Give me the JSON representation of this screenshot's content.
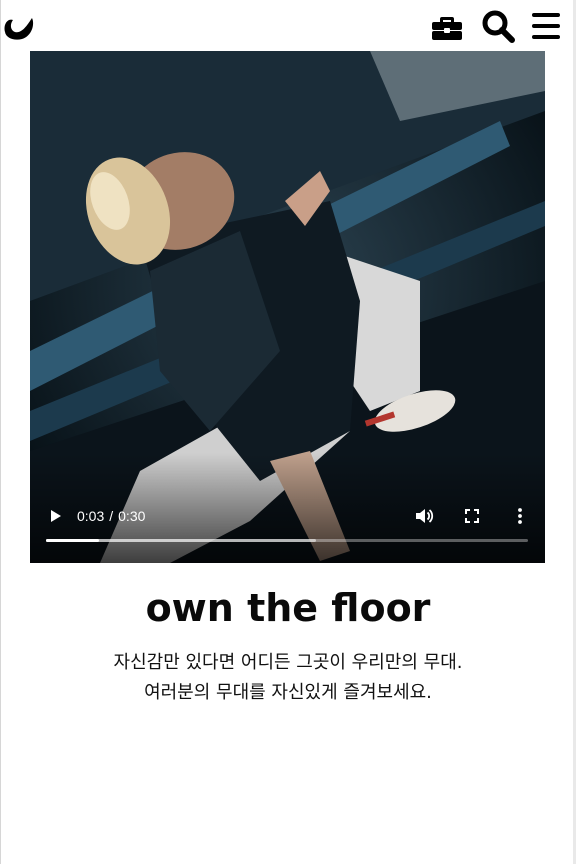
{
  "header": {
    "logo_icon": "brand-swoosh-logo",
    "icons": [
      "briefcase-icon",
      "search-icon",
      "menu-icon"
    ]
  },
  "video": {
    "current_time": "0:03",
    "separator": "/",
    "duration": "0:30",
    "played_fraction": 0.11,
    "buffered_fraction": 0.56,
    "state": "paused",
    "controls": [
      "play-icon",
      "volume-icon",
      "fullscreen-icon",
      "more-icon"
    ]
  },
  "content": {
    "title": "own the floor",
    "description_line1": "자신감만 있다면 어디든 그곳이 우리만의 무대.",
    "description_line2": "여러분의 무대를 자신있게 즐겨보세요."
  },
  "colors": {
    "text": "#0a0a0a",
    "video_bg": "#0d1a24",
    "controls": "#ffffff"
  }
}
